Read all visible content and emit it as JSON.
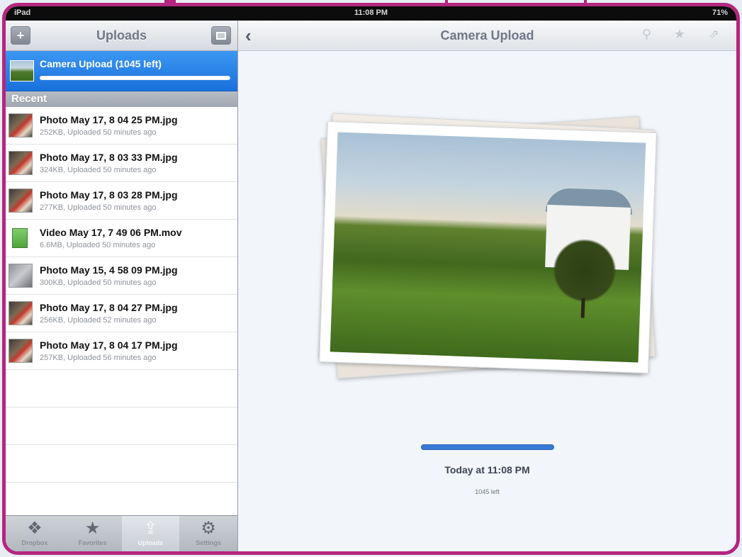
{
  "statusbar": {
    "carrier": "iPad",
    "time": "11:08 PM",
    "battery": "71%"
  },
  "sidebar": {
    "title": "Uploads",
    "add_label": "+",
    "camera_upload": {
      "label": "Camera Upload (1045 left)",
      "progress": 0.98
    },
    "section_title": "Recent",
    "files": [
      {
        "name": "Photo May 17, 8 04 25 PM.jpg",
        "meta": "252KB, Uploaded 50 minutes ago",
        "type": "photo"
      },
      {
        "name": "Photo May 17, 8 03 33 PM.jpg",
        "meta": "324KB, Uploaded 50 minutes ago",
        "type": "photo"
      },
      {
        "name": "Photo May 17, 8 03 28 PM.jpg",
        "meta": "277KB, Uploaded 50 minutes ago",
        "type": "photo"
      },
      {
        "name": "Video May 17, 7 49 06 PM.mov",
        "meta": "6.6MB, Uploaded 50 minutes ago",
        "type": "video"
      },
      {
        "name": "Photo May 15, 4 58 09 PM.jpg",
        "meta": "300KB, Uploaded 50 minutes ago",
        "type": "photo-gray"
      },
      {
        "name": "Photo May 17, 8 04 27 PM.jpg",
        "meta": "256KB, Uploaded 52 minutes ago",
        "type": "photo"
      },
      {
        "name": "Photo May 17, 8 04 17 PM.jpg",
        "meta": "257KB, Uploaded 56 minutes ago",
        "type": "photo"
      }
    ]
  },
  "tabs": [
    {
      "label": "Dropbox",
      "icon": "dropbox-icon",
      "glyph": "❖",
      "active": false
    },
    {
      "label": "Favorites",
      "icon": "star-icon",
      "glyph": "★",
      "active": false
    },
    {
      "label": "Uploads",
      "icon": "upload-icon",
      "glyph": "⇪",
      "active": true
    },
    {
      "label": "Settings",
      "icon": "gear-icon",
      "glyph": "⚙",
      "active": false
    }
  ],
  "main": {
    "title": "Camera Upload",
    "back_glyph": "‹",
    "link_glyph": "⚲",
    "star_glyph": "★",
    "share_glyph": "⇗",
    "status_time": "Today at 11:08 PM",
    "remaining": "1045 left",
    "progress": 1.0
  },
  "colors": {
    "frame": "#b4267f",
    "selection": "#1a70dc",
    "progress": "#3779d6"
  }
}
